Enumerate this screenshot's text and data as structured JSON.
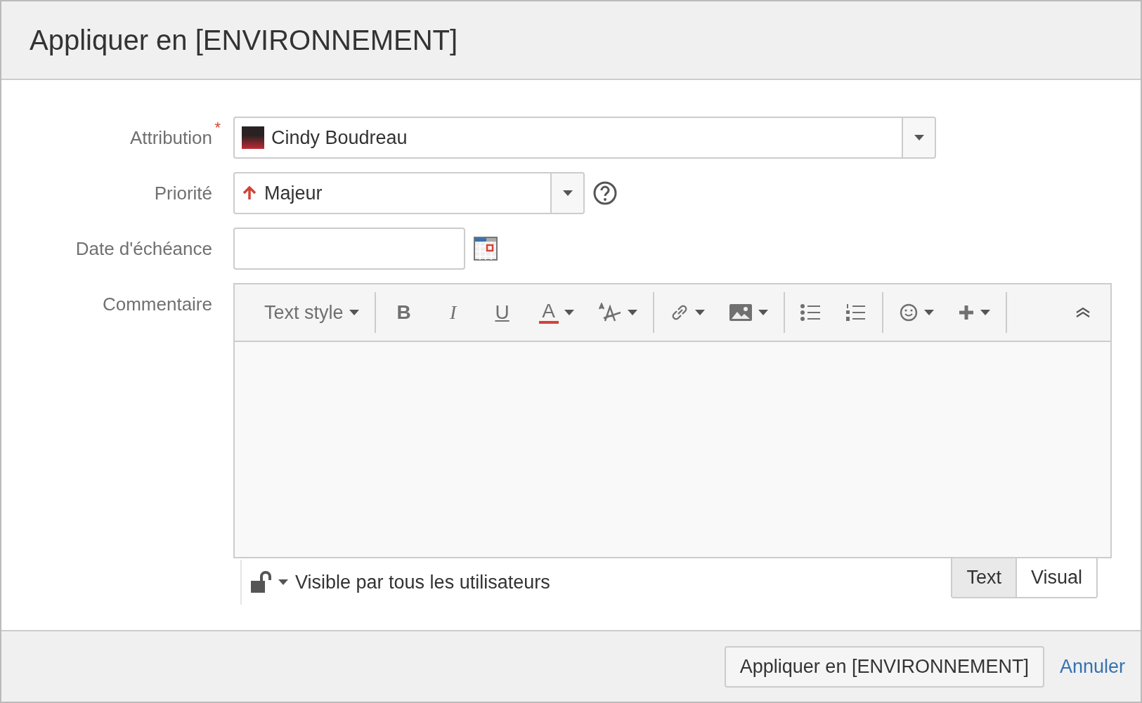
{
  "dialog": {
    "title": "Appliquer en [ENVIRONNEMENT]"
  },
  "fields": [
    {
      "kind": "user",
      "label": "Attribution",
      "required_mark": "*",
      "value": "Cindy Boudreau"
    },
    {
      "kind": "priority",
      "label": "Priorité",
      "value": "Majeur"
    },
    {
      "kind": "date",
      "label": "Date d'échéance"
    }
  ],
  "comment": {
    "label": "Commentaire",
    "toolbar": [
      [
        {
          "kind": "text-style",
          "label": "Text style",
          "dropdown": true
        }
      ],
      [
        {
          "kind": "bold",
          "glyph": "B",
          "dropdown": false
        },
        {
          "kind": "italic",
          "glyph": "I",
          "dropdown": false
        },
        {
          "kind": "underline",
          "glyph": "U",
          "dropdown": false
        },
        {
          "kind": "color",
          "glyph": "A",
          "dropdown": true
        },
        {
          "kind": "size",
          "dropdown": true
        }
      ],
      [
        {
          "kind": "link",
          "dropdown": true
        },
        {
          "kind": "image",
          "dropdown": true
        }
      ],
      [
        {
          "kind": "bullets",
          "dropdown": false
        },
        {
          "kind": "numbers",
          "dropdown": false
        }
      ],
      [
        {
          "kind": "emoji",
          "dropdown": true
        },
        {
          "kind": "insert",
          "dropdown": true
        }
      ]
    ],
    "visibility": "Visible par tous les utilisateurs",
    "modes": [
      {
        "label": "Text",
        "selected": true
      },
      {
        "label": "Visual",
        "selected": false
      }
    ]
  },
  "footer": {
    "submit": "Appliquer en [ENVIRONNEMENT]",
    "cancel": "Annuler"
  }
}
